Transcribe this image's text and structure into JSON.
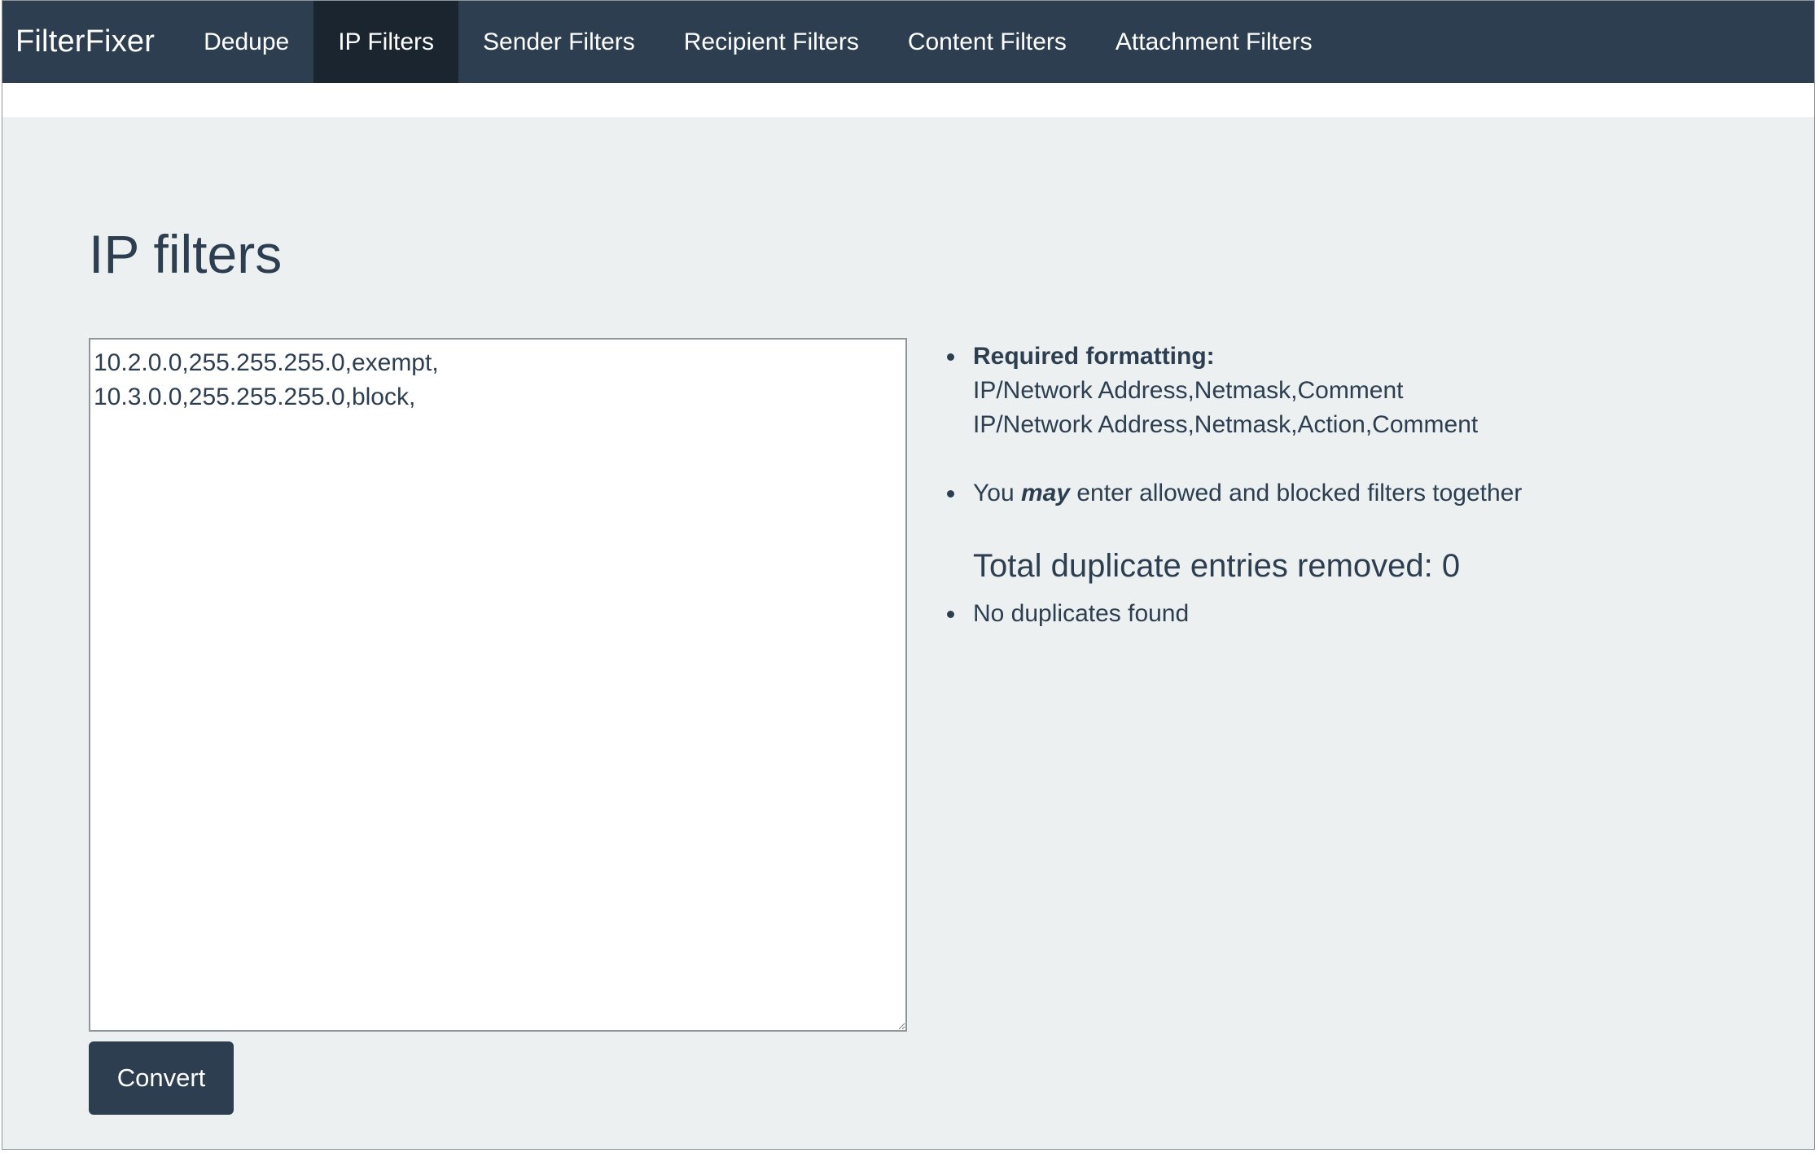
{
  "app": {
    "brand": "FilterFixer"
  },
  "nav": {
    "items": [
      {
        "label": "Dedupe"
      },
      {
        "label": "IP Filters",
        "active": true
      },
      {
        "label": "Sender Filters"
      },
      {
        "label": "Recipient Filters"
      },
      {
        "label": "Content Filters"
      },
      {
        "label": "Attachment Filters"
      }
    ]
  },
  "main": {
    "title": "IP filters",
    "input_value": "10.2.0.0,255.255.255.0,exempt,\n10.3.0.0,255.255.255.0,block,",
    "convert_label": "Convert"
  },
  "info": {
    "required_label": "Required formatting:",
    "format_line_1": "IP/Network Address,Netmask,Comment",
    "format_line_2": "IP/Network Address,Netmask,Action,Comment",
    "may_prefix": "You",
    "may_word": "may",
    "may_suffix": "enter allowed and blocked filters together",
    "total_duplicates": "Total duplicate entries removed: 0",
    "duplicates_status": "No duplicates found"
  },
  "colors": {
    "nav_bg": "#2c3e50",
    "nav_active_bg": "#1a252f",
    "page_bg": "#ecf0f1",
    "text": "#2c3e50",
    "button_bg": "#2c3e50"
  }
}
